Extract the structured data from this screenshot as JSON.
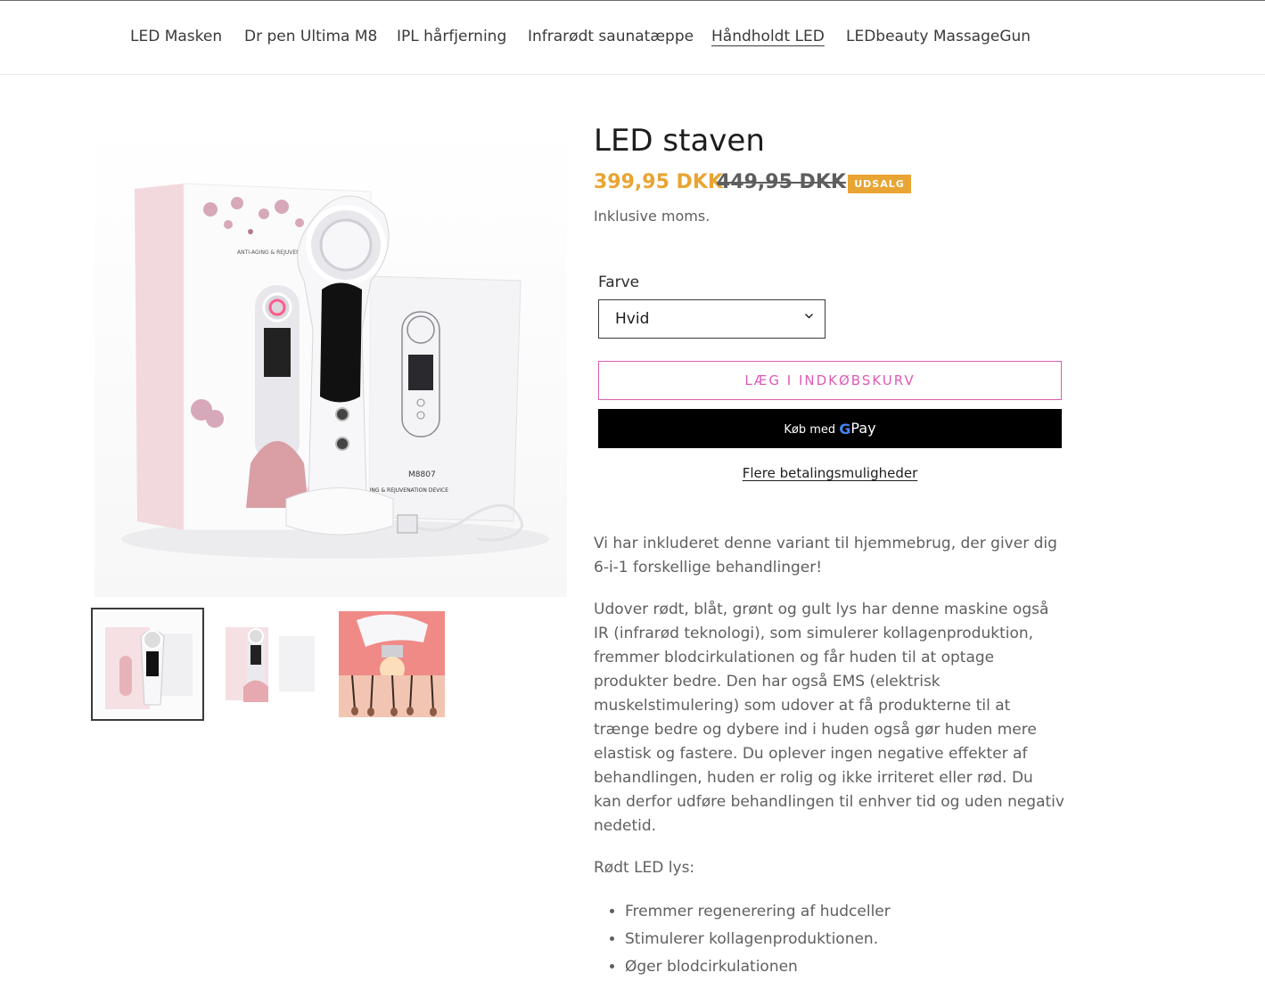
{
  "nav": {
    "items": [
      {
        "label": "LED Masken"
      },
      {
        "label": "Dr pen Ultima M8"
      },
      {
        "label": "IPL hårfjerning"
      },
      {
        "label": "Infrarødt saunatæppe"
      },
      {
        "label": "Håndholdt LED",
        "active": true
      },
      {
        "label": "LEDbeauty MassageGun"
      }
    ]
  },
  "product": {
    "title": "LED staven",
    "sale_price": "399,95 DKK",
    "compare_price": "449,95 DKK",
    "badge": "UDSALG",
    "tax_note": "Inklusive moms.",
    "variant_label": "Farve",
    "variant_value": "Hvid",
    "add_to_cart": "LÆG I INDKØBSKURV",
    "gpay_prefix": "Køb med",
    "gpay_brand_g": "G",
    "gpay_brand_pay": "Pay",
    "more_payment": "Flere betalingsmuligheder"
  },
  "images": {
    "main_text_1": "ANTI-AGING & REJUVENATION",
    "main_text_2": "M8807",
    "main_text_3": "AGING & REJUVENATION DEVICE",
    "thumbnails": [
      "white-device",
      "pink-device",
      "skin-diagram"
    ]
  },
  "description": {
    "p1": "Vi har inkluderet denne variant til hjemmebrug, der giver dig 6-i-1 forskellige behandlinger!",
    "p2": "Udover rødt, blåt, grønt og gult lys har denne maskine også IR (infrarød teknologi), som simulerer kollagenproduktion, fremmer blodcirkulationen og får huden til at optage produkter bedre. Den har også EMS (elektrisk muskelstimulering) som udover at få produkterne til at trænge bedre og dybere ind i huden også gør huden mere elastisk og fastere. Du oplever ingen negative effekter af behandlingen, huden er rolig og ikke irriteret eller rød. Du kan derfor udføre behandlingen til enhver tid og uden negativ nedetid.",
    "p3": "Rødt LED lys:",
    "bullets": [
      "Fremmer regenerering af hudceller",
      "Stimulerer kollagenproduktionen.",
      "Øger blodcirkulationen"
    ]
  },
  "colors": {
    "accent_price": "#e8a533",
    "cart_button": "#dd5bb6",
    "text_dark": "#1c1d1d",
    "text_muted": "#5f5f5f"
  }
}
